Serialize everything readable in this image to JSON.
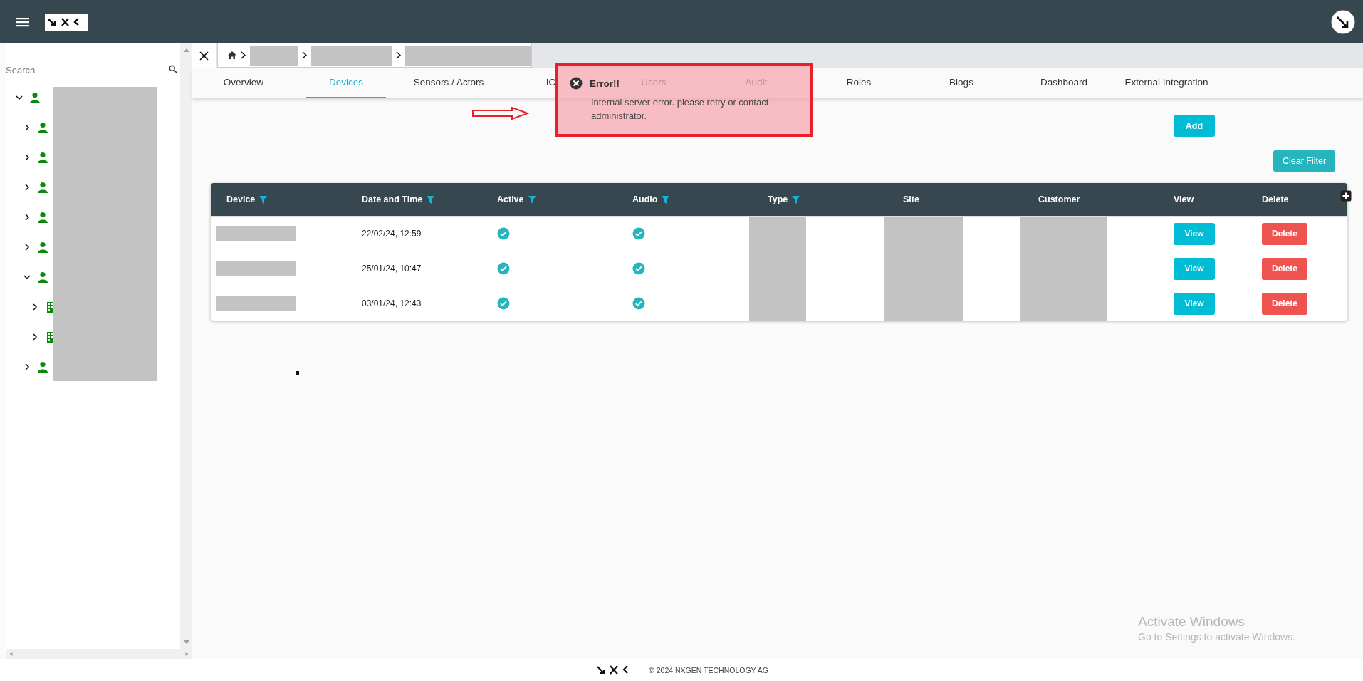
{
  "sidebar": {
    "search": {
      "placeholder": "Search"
    },
    "tree": [
      {
        "kind": "user",
        "expanded": true,
        "children": [
          {
            "kind": "user",
            "expanded": false
          },
          {
            "kind": "user",
            "expanded": false
          },
          {
            "kind": "user",
            "expanded": false
          },
          {
            "kind": "user",
            "expanded": false
          },
          {
            "kind": "user",
            "expanded": false
          },
          {
            "kind": "user",
            "expanded": true,
            "children": [
              {
                "kind": "building",
                "expanded": false
              },
              {
                "kind": "building",
                "expanded": false
              }
            ]
          },
          {
            "kind": "user",
            "expanded": false
          }
        ]
      }
    ]
  },
  "tabs": [
    {
      "label": "Overview",
      "selected": false
    },
    {
      "label": "Devices",
      "selected": true
    },
    {
      "label": "Sensors / Actors",
      "selected": false
    },
    {
      "label": "IO",
      "selected": false
    },
    {
      "label": "Users",
      "selected": false
    },
    {
      "label": "Audit",
      "selected": false
    },
    {
      "label": "Roles",
      "selected": false
    },
    {
      "label": "Blogs",
      "selected": false
    },
    {
      "label": "Dashboard",
      "selected": false
    },
    {
      "label": "External Integration",
      "selected": false
    }
  ],
  "toast": {
    "kind": "error",
    "title": "Error!!",
    "message": "Internal server error. please retry or contact administrator."
  },
  "actions": {
    "add": "Add",
    "clear_filter": "Clear Filter"
  },
  "table": {
    "columns": [
      {
        "label": "Device",
        "filter": true
      },
      {
        "label": "Date and Time",
        "filter": true
      },
      {
        "label": "Active",
        "filter": true
      },
      {
        "label": "Audio",
        "filter": true
      },
      {
        "label": "Type",
        "filter": true
      },
      {
        "label": "Site",
        "filter": false
      },
      {
        "label": "Customer",
        "filter": false
      },
      {
        "label": "View",
        "filter": false
      },
      {
        "label": "Delete",
        "filter": false
      }
    ],
    "rows": [
      {
        "date": "22/02/24, 12:59",
        "active": true,
        "audio": true,
        "view": "View",
        "delete": "Delete"
      },
      {
        "date": "25/01/24, 10:47",
        "active": true,
        "audio": true,
        "view": "View",
        "delete": "Delete"
      },
      {
        "date": "03/01/24, 12:43",
        "active": true,
        "audio": true,
        "view": "View",
        "delete": "Delete"
      }
    ]
  },
  "footer": {
    "copyright": "© 2024 NXGEN TECHNOLOGY AG"
  },
  "os_overlay": {
    "title": "Activate Windows",
    "subtitle": "Go to Settings to activate Windows."
  }
}
